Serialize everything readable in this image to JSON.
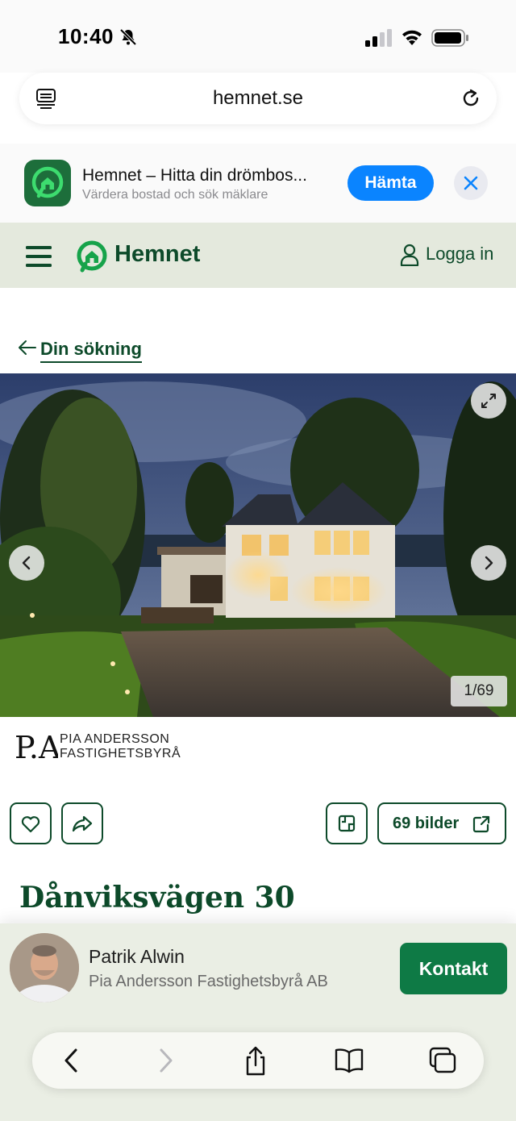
{
  "status_bar": {
    "time": "10:40"
  },
  "browser": {
    "url": "hemnet.se"
  },
  "app_banner": {
    "title": "Hemnet – Hitta din drömbos...",
    "subtitle": "Värdera bostad och sök mäklare",
    "get_label": "Hämta"
  },
  "site_header": {
    "brand": "Hemnet",
    "login_label": "Logga in"
  },
  "back_link": {
    "label": "Din sökning"
  },
  "gallery": {
    "counter": "1/69",
    "all_images_label": "69 bilder"
  },
  "agency": {
    "line1": "PIA ANDERSSON",
    "line2": "FASTIGHETSBYRÅ",
    "monogram": "P.A"
  },
  "listing": {
    "address": "Dånviksvägen 30"
  },
  "contact": {
    "agent_name": "Patrik Alwin",
    "agent_company": "Pia Andersson Fastighetsbyrå AB",
    "contact_label": "Kontakt"
  },
  "colors": {
    "brand_green": "#0d4a2a",
    "accent_green": "#0e7a45",
    "ios_blue": "#0a84ff"
  }
}
